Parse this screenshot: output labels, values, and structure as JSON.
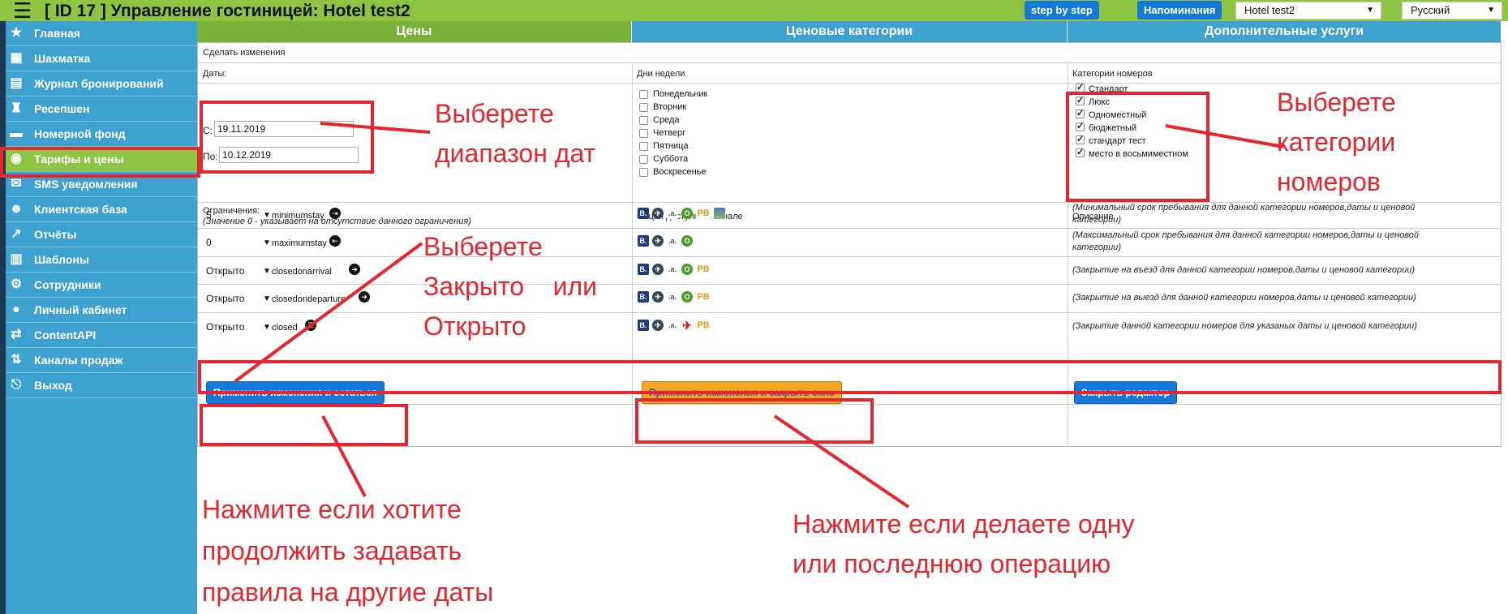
{
  "topbar": {
    "title": "[ ID 17 ] Управление гостиницей: Hotel test2",
    "step_button": "step by step",
    "reminders_button": "Напоминания",
    "hotel_select": "Hotel test2",
    "language_select": "Русский"
  },
  "sidebar": {
    "items": [
      {
        "label": "Главная",
        "icon": "star-icon",
        "glyph": "★"
      },
      {
        "label": "Шахматка",
        "icon": "grid-icon",
        "glyph": "▦"
      },
      {
        "label": "Журнал бронирований",
        "icon": "book-icon",
        "glyph": "▤"
      },
      {
        "label": "Ресепшен",
        "icon": "bell-icon",
        "glyph": "♜"
      },
      {
        "label": "Номерной фонд",
        "icon": "bed-icon",
        "glyph": "▬"
      },
      {
        "label": "Тарифы и цены",
        "icon": "wallet-icon",
        "glyph": "◉"
      },
      {
        "label": "SMS уведомления",
        "icon": "sms-icon",
        "glyph": "✉"
      },
      {
        "label": "Клиентская база",
        "icon": "user-face-icon",
        "glyph": "☻"
      },
      {
        "label": "Отчёты",
        "icon": "chart-icon",
        "glyph": "↗"
      },
      {
        "label": "Шаблоны",
        "icon": "template-icon",
        "glyph": "▥"
      },
      {
        "label": "Сотрудники",
        "icon": "gear-icon",
        "glyph": "⚙"
      },
      {
        "label": "Личный кабинет",
        "icon": "person-icon",
        "glyph": "●"
      },
      {
        "label": "ContentAPI",
        "icon": "api-icon",
        "glyph": "⇄"
      },
      {
        "label": "Каналы продаж",
        "icon": "channels-icon",
        "glyph": "⇅"
      },
      {
        "label": "Выход",
        "icon": "exit-icon",
        "glyph": "⎋"
      }
    ],
    "active_index": 5
  },
  "tabs": [
    "Цены",
    "Ценовые категории",
    "Дополнительные услуги"
  ],
  "form": {
    "make_changes": "Сделать изменения",
    "dates_header": "Даты:",
    "weekdays_header": "Дни недели",
    "room_cats_header": "Категории номеров",
    "from_label": "С:",
    "from_value": "19.11.2019",
    "to_label": "По:",
    "to_value": "10.12.2019",
    "weekdays": [
      "Понедельник",
      "Вторник",
      "Среда",
      "Четверг",
      "Пятница",
      "Суббота",
      "Воскресенье"
    ],
    "room_categories": [
      "Стандарт",
      "Люкс",
      "Одноместный",
      "бюджетный",
      "стандарт тест",
      "место в восьмиместном"
    ],
    "restrictions_header": "Ограничения:",
    "restrictions_note": "(Значение 0 - указывает на отсутствие данного ограничения)",
    "channel_header": "Опция доступна в канале",
    "description_header": "Описание",
    "restrictions": [
      {
        "value": "5",
        "name": "minimumstay",
        "desc": "(Минимальный срок пребывания для данной категории номеров,даты и ценовой категории)"
      },
      {
        "value": "0",
        "name": "maximumstay",
        "desc": "(Максимальный срок пребывания для данной категории номеров,даты и ценовой категории)"
      },
      {
        "value": "Открыто",
        "name": "closedonarrival",
        "desc": "(Закрытие на въезд для данной категории номеров,даты и ценовой категории)"
      },
      {
        "value": "Открыто",
        "name": "closedondeparture",
        "desc": "(Закрытие на выезд для данной категории номеров,даты и ценовой категории)"
      },
      {
        "value": "Открыто",
        "name": "closed",
        "desc": "(Закрытие данной категории номеров для указаных даты и ценовой категории)"
      }
    ],
    "apply_stay_button": "Применить изменения и остаться",
    "apply_close_button": "Применить изменения и закрыть окно",
    "close_editor_button": "Закрыть редактор"
  },
  "annotations": {
    "select_dates_1": "Выберете",
    "select_dates_2": "диапазон дат",
    "select_cats_1": "Выберете",
    "select_cats_2": "категории",
    "select_cats_3": "номеров",
    "select_open_1": "Выберете",
    "select_open_2": "Закрыто    или",
    "select_open_3": "Открыто",
    "stay_1": "Нажмите если хотите",
    "stay_2": "продолжить задавать",
    "stay_3": "правила на другие даты",
    "close_1": "Нажмите если делаете одну",
    "close_2": "или последнюю операцию"
  },
  "colors": {
    "annotation": "#e8242c",
    "sidebar": "#3da2cf",
    "active": "#8dc542",
    "button": "#1479d7"
  }
}
